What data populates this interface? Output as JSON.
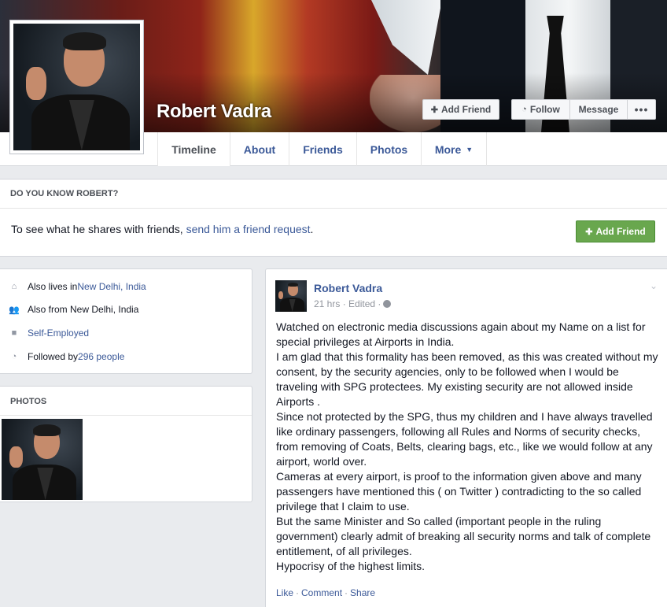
{
  "profile": {
    "name": "Robert Vadra",
    "buttons": {
      "add_friend": "Add Friend",
      "follow": "Follow",
      "message": "Message",
      "more_dots": "•••"
    }
  },
  "tabs": [
    {
      "label": "Timeline"
    },
    {
      "label": "About"
    },
    {
      "label": "Friends"
    },
    {
      "label": "Photos"
    },
    {
      "label": "More"
    }
  ],
  "know_box": {
    "heading": "DO YOU KNOW ROBERT?",
    "text_prefix": "To see what he shares with friends, ",
    "link": "send him a friend request",
    "text_suffix": ".",
    "button": "Add Friend"
  },
  "intro": [
    {
      "icon": "home-icon",
      "prefix": "Also lives in ",
      "link": "New Delhi, India",
      "suffix": ""
    },
    {
      "icon": "people-icon",
      "prefix": "Also from New Delhi, India",
      "link": "",
      "suffix": ""
    },
    {
      "icon": "briefcase-icon",
      "prefix": "",
      "link": "Self-Employed",
      "suffix": ""
    },
    {
      "icon": "rss-icon",
      "prefix": "Followed by ",
      "link": "296 people",
      "suffix": ""
    }
  ],
  "photos": {
    "heading": "PHOTOS"
  },
  "post": {
    "author": "Robert Vadra",
    "time": "21 hrs",
    "edited": "Edited",
    "lines": [
      "Watched on electronic media discussions again about my Name on a list for special privileges at Airports in India.",
      "I am glad that this formality has been removed, as this was created without my consent, by the security agencies, only to be followed when I would be traveling with SPG protectees. My existing security are not allowed inside Airports .",
      "Since not protected by the SPG, thus my children and I have always travelled like ordinary passengers, following all Rules and Norms of security checks, from removing of Coats, Belts, clearing bags, etc., like we would follow at any airport, world over.",
      "Cameras at every airport, is proof to the information given above and many passengers have mentioned this ( on Twitter ) contradicting to the so called privilege that I claim to use.",
      "But the same Minister and So called (important people in the ruling government) clearly admit of breaking all security norms and talk of complete entitlement, of all privileges.",
      "Hypocrisy of the highest limits."
    ],
    "actions": {
      "like": "Like",
      "comment": "Comment",
      "share": "Share"
    }
  },
  "colors": {
    "link": "#3b5998",
    "green_button": "#69a74e",
    "background": "#e9ebee"
  }
}
